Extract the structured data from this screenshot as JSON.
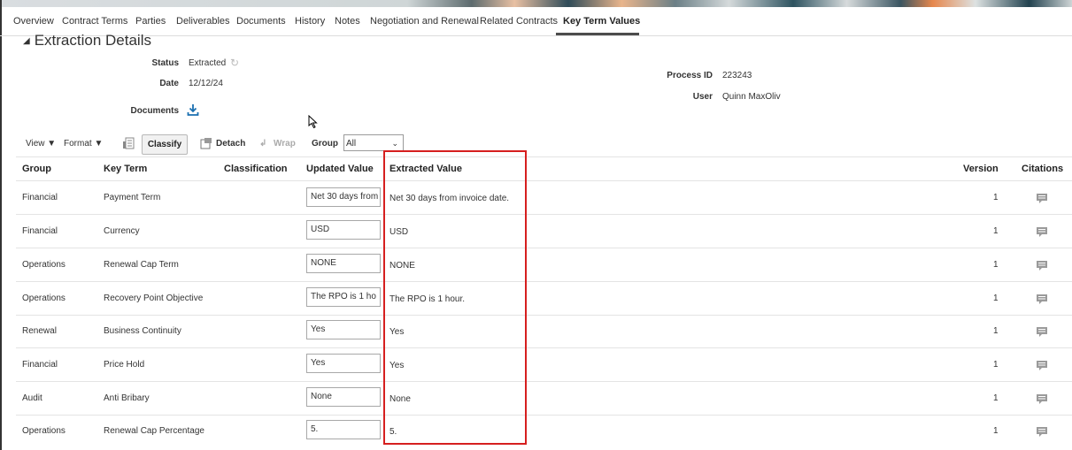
{
  "tabs": [
    "Overview",
    "Contract Terms",
    "Parties",
    "Deliverables",
    "Documents",
    "History",
    "Notes",
    "Negotiation and Renewal",
    "Related Contracts",
    "Key Term Values"
  ],
  "active_tab": "Key Term Values",
  "section": {
    "title": "Extraction Details"
  },
  "details": {
    "status_label": "Status",
    "status_value": "Extracted",
    "date_label": "Date",
    "date_value": "12/12/24",
    "documents_label": "Documents",
    "process_id_label": "Process ID",
    "process_id_value": "223243",
    "user_label": "User",
    "user_value": "Quinn MaxOliv"
  },
  "toolbar": {
    "view": "View",
    "format": "Format",
    "classify": "Classify",
    "detach": "Detach",
    "wrap": "Wrap",
    "group_label": "Group",
    "group_value": "All"
  },
  "columns": [
    "Group",
    "Key Term",
    "Classification",
    "Updated Value",
    "Extracted Value",
    "Version",
    "Citations"
  ],
  "rows": [
    {
      "group": "Financial",
      "key_term": "Payment Term",
      "updated": "Net 30 days from",
      "extracted": "Net 30 days from invoice date.",
      "version": "1"
    },
    {
      "group": "Financial",
      "key_term": "Currency",
      "updated": "USD",
      "extracted": "USD",
      "version": "1"
    },
    {
      "group": "Operations",
      "key_term": "Renewal Cap Term",
      "updated": "NONE",
      "extracted": "NONE",
      "version": "1"
    },
    {
      "group": "Operations",
      "key_term": "Recovery Point Objective",
      "updated": "The RPO is 1 ho",
      "extracted": "The RPO is 1 hour.",
      "version": "1"
    },
    {
      "group": "Renewal",
      "key_term": "Business Continuity",
      "updated": "Yes",
      "extracted": "Yes",
      "version": "1"
    },
    {
      "group": "Financial",
      "key_term": "Price Hold",
      "updated": "Yes",
      "extracted": "Yes",
      "version": "1"
    },
    {
      "group": "Audit",
      "key_term": "Anti Bribary",
      "updated": "None",
      "extracted": "None",
      "version": "1"
    },
    {
      "group": "Operations",
      "key_term": "Renewal Cap Percentage",
      "updated": "5.",
      "extracted": "5.",
      "version": "1"
    }
  ],
  "colors": {
    "highlight": "#d61f1f",
    "accent": "#1a6fb0"
  }
}
